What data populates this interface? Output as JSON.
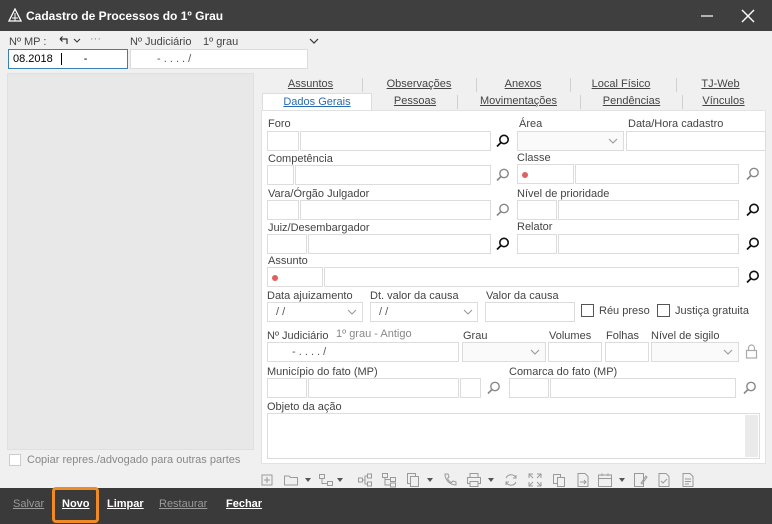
{
  "window": {
    "title": "Cadastro de Processos do 1º Grau",
    "minimize_icon": "minimize-icon",
    "close_icon": "close-icon"
  },
  "header": {
    "mp_label": "Nº MP :",
    "undo_icon": "undo-icon",
    "more": "···",
    "judiciario_label": "Nº Judiciário",
    "grau_label": "1º grau",
    "mp_value": "08.2018",
    "mp_value_suffix": "-",
    "judiciario_value": "-   .   .   .   . /"
  },
  "left_panel": {
    "copy_label": "Copiar repres./advogado para outras partes"
  },
  "tabs": {
    "row1": [
      "Assuntos",
      "Observações",
      "Anexos",
      "Local Físico",
      "TJ-Web"
    ],
    "row2": [
      "Dados Gerais",
      "Pessoas",
      "Movimentações",
      "Pendências",
      "Vínculos"
    ],
    "active": "Dados Gerais"
  },
  "form": {
    "foro_label": "Foro",
    "area_label": "Área",
    "data_hora_label": "Data/Hora cadastro",
    "competencia_label": "Competência",
    "classe_label": "Classe",
    "vara_label": "Vara/Órgão Julgador",
    "prioridade_label": "Nível de prioridade",
    "juiz_label": "Juiz/Desembargador",
    "relator_label": "Relator",
    "assunto_label": "Assunto",
    "data_ajuizamento_label": "Data ajuizamento",
    "data_ajuizamento_value": "/ /",
    "dt_valor_label": "Dt. valor da causa",
    "dt_valor_value": "/ /",
    "valor_causa_label": "Valor da causa",
    "reu_preso_label": "Réu preso",
    "justica_gratuita_label": "Justiça gratuita",
    "judiciario_label": "Nº Judiciário",
    "judiciario_hint": "1º grau - Antigo",
    "judiciario_value": "-   .   .   .   . /",
    "grau_label": "Grau",
    "volumes_label": "Volumes",
    "folhas_label": "Folhas",
    "sigilo_label": "Nível de sigilo",
    "municipio_label": "Município do fato (MP)",
    "comarca_label": "Comarca do fato (MP)",
    "objeto_label": "Objeto da ação"
  },
  "bottom": {
    "salvar": "Salvar",
    "novo": "Novo",
    "limpar": "Limpar",
    "restaurar": "Restaurar",
    "fechar": "Fechar"
  },
  "colors": {
    "titlebar": "#3f3f3f",
    "accent": "#3c7fb1",
    "highlight": "#f08a24",
    "required_dot": "#e06060"
  }
}
